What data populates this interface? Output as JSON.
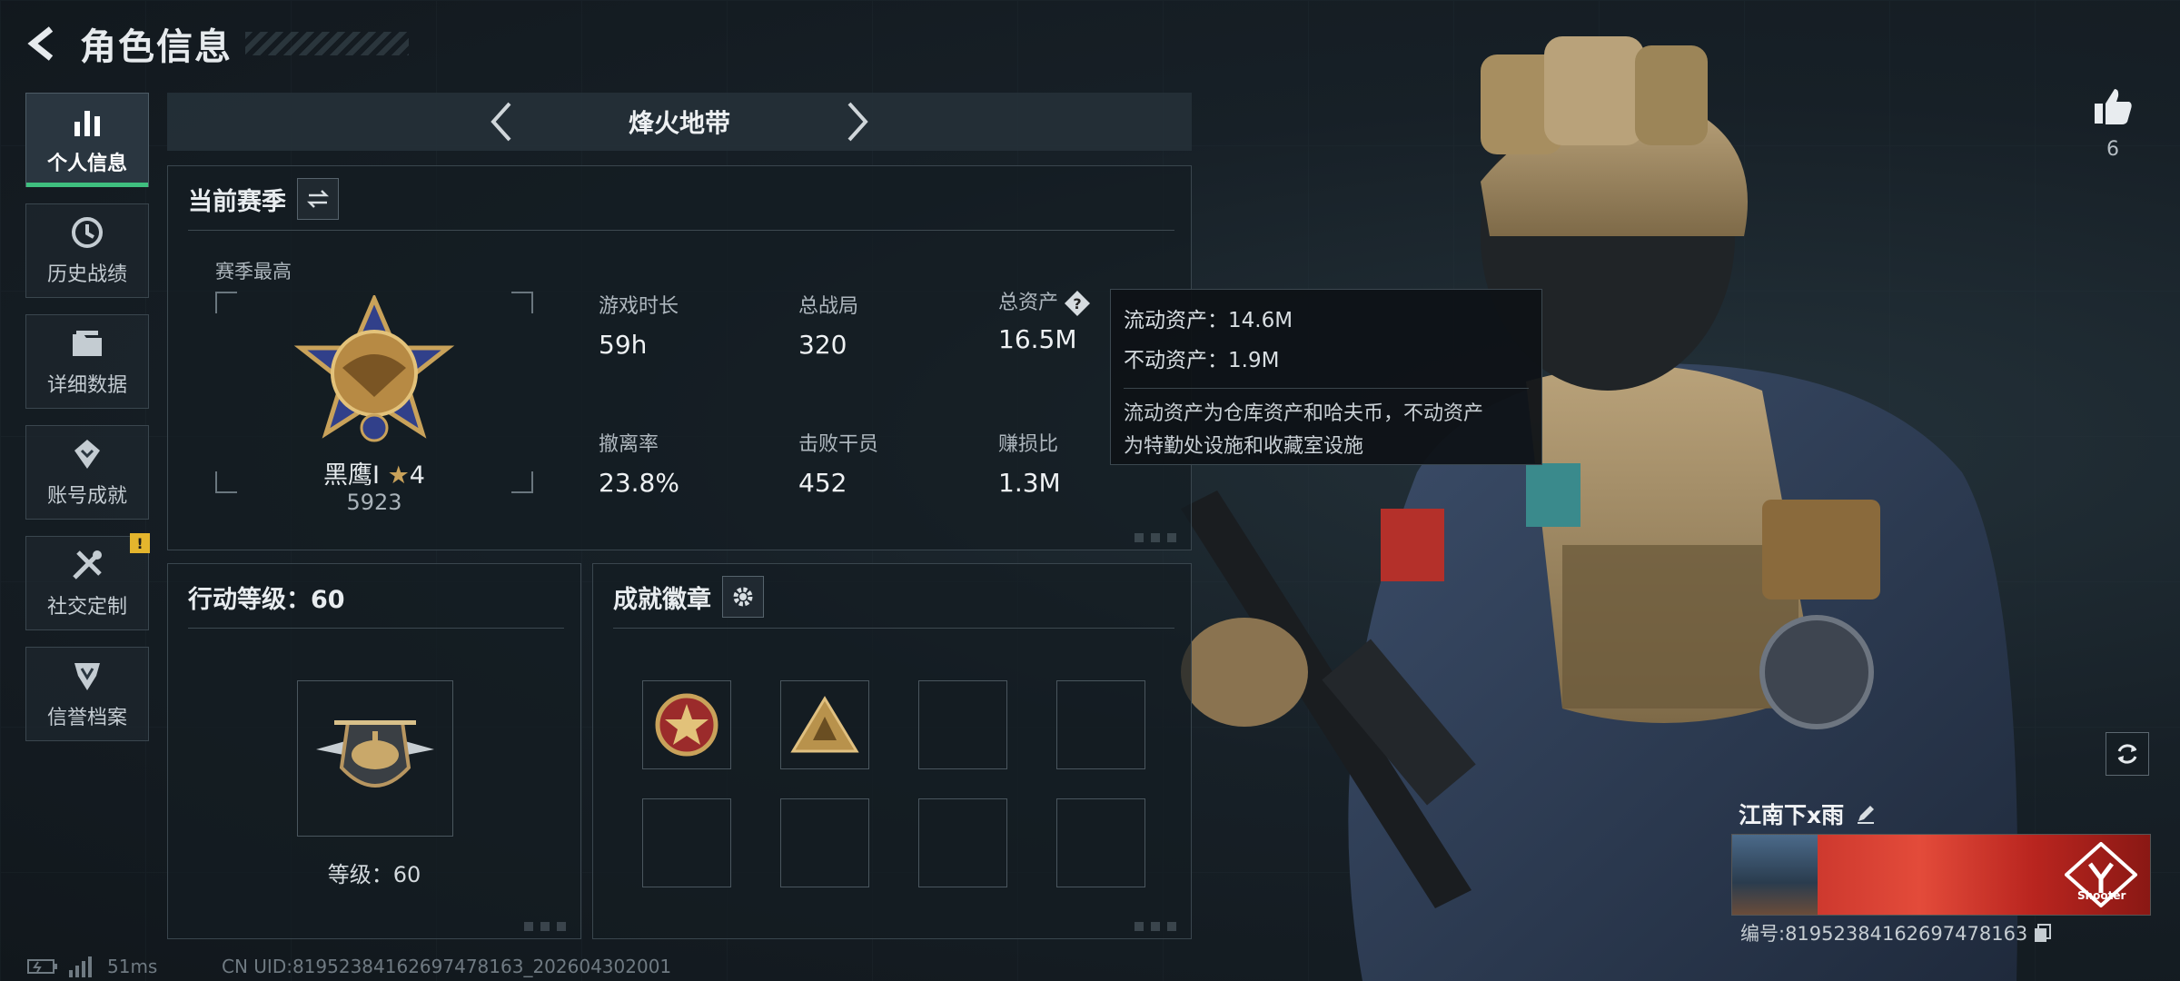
{
  "header": {
    "title": "角色信息"
  },
  "sidebar": {
    "items": [
      {
        "label": "个人信息",
        "icon": "bar-chart-icon",
        "active": true
      },
      {
        "label": "历史战绩",
        "icon": "history-clock-icon"
      },
      {
        "label": "详细数据",
        "icon": "folder-icon"
      },
      {
        "label": "账号成就",
        "icon": "achievement-icon"
      },
      {
        "label": "社交定制",
        "icon": "tools-icon",
        "badge": "!"
      },
      {
        "label": "信誉档案",
        "icon": "shield-credit-icon"
      }
    ]
  },
  "mode_bar": {
    "title": "烽火地带"
  },
  "season": {
    "title": "当前赛季",
    "best_label": "赛季最高",
    "rank_name": "黑鹰I",
    "rank_stars": "4",
    "rank_score": "5923",
    "stats": [
      {
        "label": "游戏时长",
        "value": "59h"
      },
      {
        "label": "总战局",
        "value": "320"
      },
      {
        "label": "总资产",
        "value": "16.5M"
      },
      {
        "label": "撤离率",
        "value": "23.8%"
      },
      {
        "label": "击败干员",
        "value": "452"
      },
      {
        "label": "赚损比",
        "value": "1.3M"
      }
    ]
  },
  "tooltip": {
    "liquid": "流动资产：14.6M",
    "fixed": "不动资产：1.9M",
    "note_line1": "流动资产为仓库资产和哈夫币，不动资产",
    "note_line2": "为特勤处设施和收藏室设施"
  },
  "level": {
    "title": "行动等级：60",
    "label": "等级：60"
  },
  "achievements": {
    "title": "成就徽章",
    "filled_slots": 2,
    "total_slots": 8
  },
  "profile": {
    "likes": "6",
    "player_name": "江南下x雨",
    "player_id": "编号:81952384162697478163",
    "banner_text": "Shooter"
  },
  "footer": {
    "latency": "51ms",
    "uid": "CN UID:81952384162697478163_202604302001"
  },
  "colors": {
    "accent_green": "#3fbf7f",
    "warning": "#e4b52d",
    "banner_red": "#d23a2f"
  }
}
